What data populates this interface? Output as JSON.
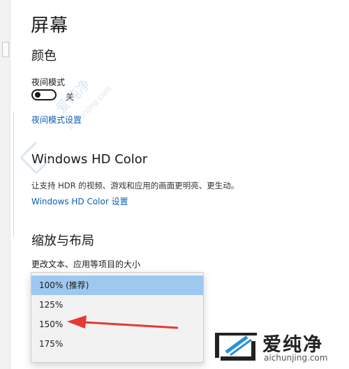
{
  "page_title": "屏幕",
  "color_section": {
    "heading": "颜色",
    "night_mode_label": "夜间模式",
    "toggle_state": "关",
    "night_settings_link": "夜间模式设置"
  },
  "hdr_section": {
    "heading": "Windows HD Color",
    "description": "让支持 HDR 的视频、游戏和应用的画面更明亮、更生动。",
    "settings_link": "Windows HD Color 设置"
  },
  "scale_section": {
    "heading": "缩放与布局",
    "scale_label": "更改文本、应用等项目的大小",
    "options": [
      "100% (推荐)",
      "125%",
      "150%",
      "175%"
    ],
    "selected_index": 0
  },
  "watermark": {
    "text_cn": "爱纯净",
    "text_en": "aichunjing.com"
  },
  "brand": {
    "name_cn": "爱纯净",
    "domain": "aichunjing.com"
  },
  "colors": {
    "link": "#0a5fb4",
    "selected_option": "#9ec8f0",
    "arrow": "#e53935"
  }
}
